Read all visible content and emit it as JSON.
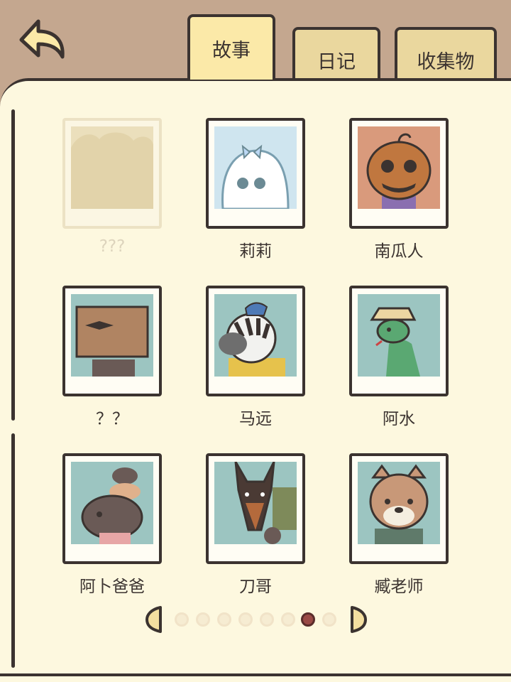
{
  "tabs": [
    {
      "label": "故事",
      "active": true
    },
    {
      "label": "日记",
      "active": false
    },
    {
      "label": "收集物",
      "active": false
    }
  ],
  "characters": [
    {
      "name": "???",
      "locked": true
    },
    {
      "name": "莉莉",
      "locked": false
    },
    {
      "name": "南瓜人",
      "locked": false
    },
    {
      "name": "？？",
      "locked": false
    },
    {
      "name": "马远",
      "locked": false
    },
    {
      "name": "阿水",
      "locked": false
    },
    {
      "name": "阿卜爸爸",
      "locked": false
    },
    {
      "name": "刀哥",
      "locked": false
    },
    {
      "name": "臧老师",
      "locked": false
    }
  ],
  "pagination": {
    "total_pages": 8,
    "current_page": 7
  },
  "icons": {
    "back": "back-arrow-icon",
    "prev": "prev-page-icon",
    "next": "next-page-icon"
  },
  "colors": {
    "background": "#c4a78f",
    "page": "#fdf8df",
    "tab": "#ead79e",
    "active_tab": "#fbe9a8",
    "outline": "#3b3330",
    "active_dot": "#9a4a46"
  }
}
